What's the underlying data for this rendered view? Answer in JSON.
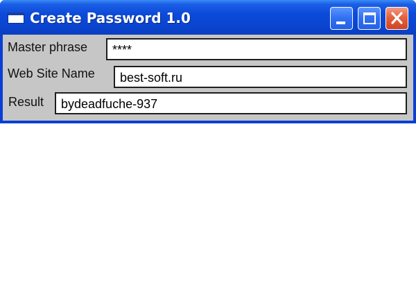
{
  "window": {
    "title": "Create Password 1.0",
    "icons": {
      "app": "window-icon",
      "minimize": "minimize-icon",
      "maximize": "maximize-icon",
      "close": "close-icon"
    },
    "colors": {
      "titlebar": "#0b4ad9",
      "close_button": "#e3623f",
      "client": "#c6c6c6"
    }
  },
  "form": {
    "master_phrase": {
      "label": "Master phrase",
      "value": "****"
    },
    "web_site_name": {
      "label": "Web Site Name",
      "value": "best-soft.ru"
    },
    "result": {
      "label": "Result",
      "value": "bydeadfuche-937"
    }
  }
}
